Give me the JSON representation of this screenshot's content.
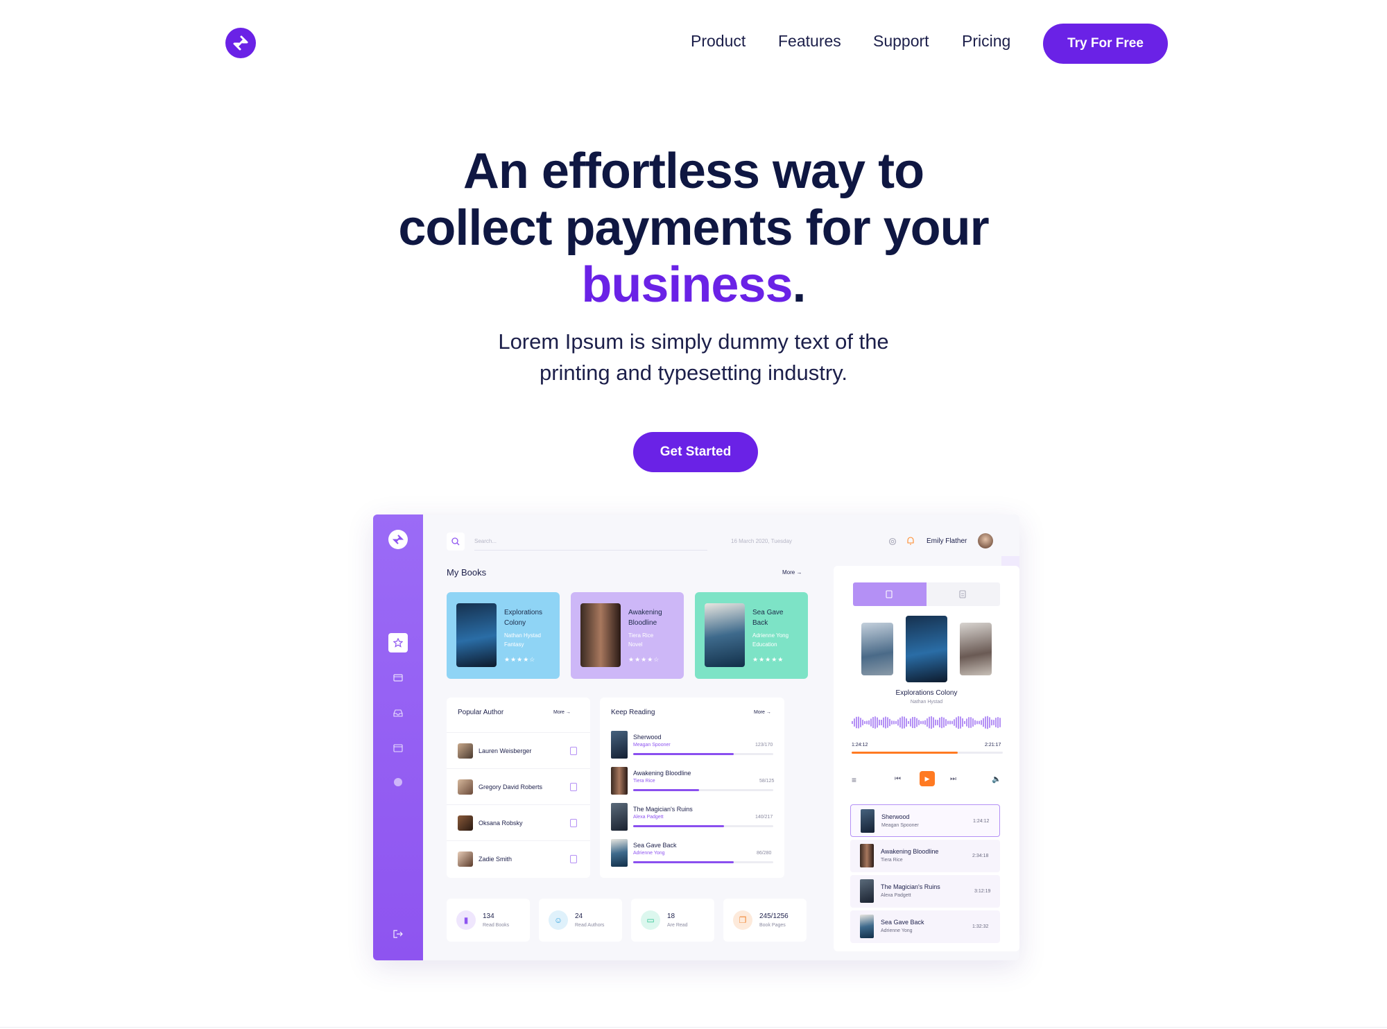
{
  "nav": {
    "items": [
      "Product",
      "Features",
      "Support",
      "Pricing"
    ],
    "cta": "Try For Free"
  },
  "hero": {
    "line1": "An effortless way to",
    "line2": "collect payments for your",
    "line3_accent": "business",
    "line3_dot": ".",
    "sub1": "Lorem Ipsum is simply dummy text of the",
    "sub2": "printing and typesetting industry.",
    "cta": "Get Started"
  },
  "colors": {
    "accent": "#6a22e6",
    "navy": "#0f1742"
  },
  "dash": {
    "search_placeholder": "Search...",
    "date": "16 March 2020, Tuesday",
    "user": "Emily Flather",
    "my_books": "My Books",
    "more": "More",
    "books": [
      {
        "title1": "Explorations",
        "title2": "Colony",
        "author": "Nathan Hystad",
        "genre": "Fantasy",
        "stars": "★★★★☆",
        "bg": "#8fd4f5"
      },
      {
        "title1": "Awakening",
        "title2": "Bloodline",
        "author": "Tiera Rice",
        "genre": "Novel",
        "stars": "★★★★☆",
        "bg": "#cdb7f7"
      },
      {
        "title1": "Sea Gave",
        "title2": "Back",
        "author": "Adrienne Yong",
        "genre": "Education",
        "stars": "★★★★★",
        "bg": "#7de3c6"
      }
    ],
    "popular_author": "Popular Author",
    "authors": [
      "Lauren Weisberger",
      "Gregory David Roberts",
      "Oksana Robsky",
      "Zadie Smith"
    ],
    "keep_reading": "Keep Reading",
    "reading": [
      {
        "title": "Sherwood",
        "author": "Meagan Spooner",
        "count": "123/170",
        "progress": 0.72
      },
      {
        "title": "Awakening Bloodline",
        "author": "Tiera Rice",
        "count": "58/125",
        "progress": 0.47
      },
      {
        "title": "The Magician's Ruins",
        "author": "Alexa Padgett",
        "count": "140/217",
        "progress": 0.65
      },
      {
        "title": "Sea Gave Back",
        "author": "Adrienne Yong",
        "count": "86/280",
        "progress": 0.72
      }
    ],
    "stats": [
      {
        "value": "134",
        "label": "Read Books"
      },
      {
        "value": "24",
        "label": "Read Authors"
      },
      {
        "value": "18",
        "label": "Are Read"
      },
      {
        "value": "245/1256",
        "label": "Book Pages"
      }
    ],
    "player": {
      "title": "Explorations Colony",
      "author": "Nathan Hystad",
      "elapsed": "1:24:12",
      "total": "2:21:17",
      "progress": 0.7
    },
    "queue": [
      {
        "title": "Sherwood",
        "author": "Meagan Spooner",
        "time": "1:24:12"
      },
      {
        "title": "Awakening Bloodline",
        "author": "Tiera Rice",
        "time": "2:34:18"
      },
      {
        "title": "The Magician's Ruins",
        "author": "Alexa Padgett",
        "time": "3:12:19"
      },
      {
        "title": "Sea Gave Back",
        "author": "Adrienne Yong",
        "time": "1:32:32"
      }
    ]
  }
}
